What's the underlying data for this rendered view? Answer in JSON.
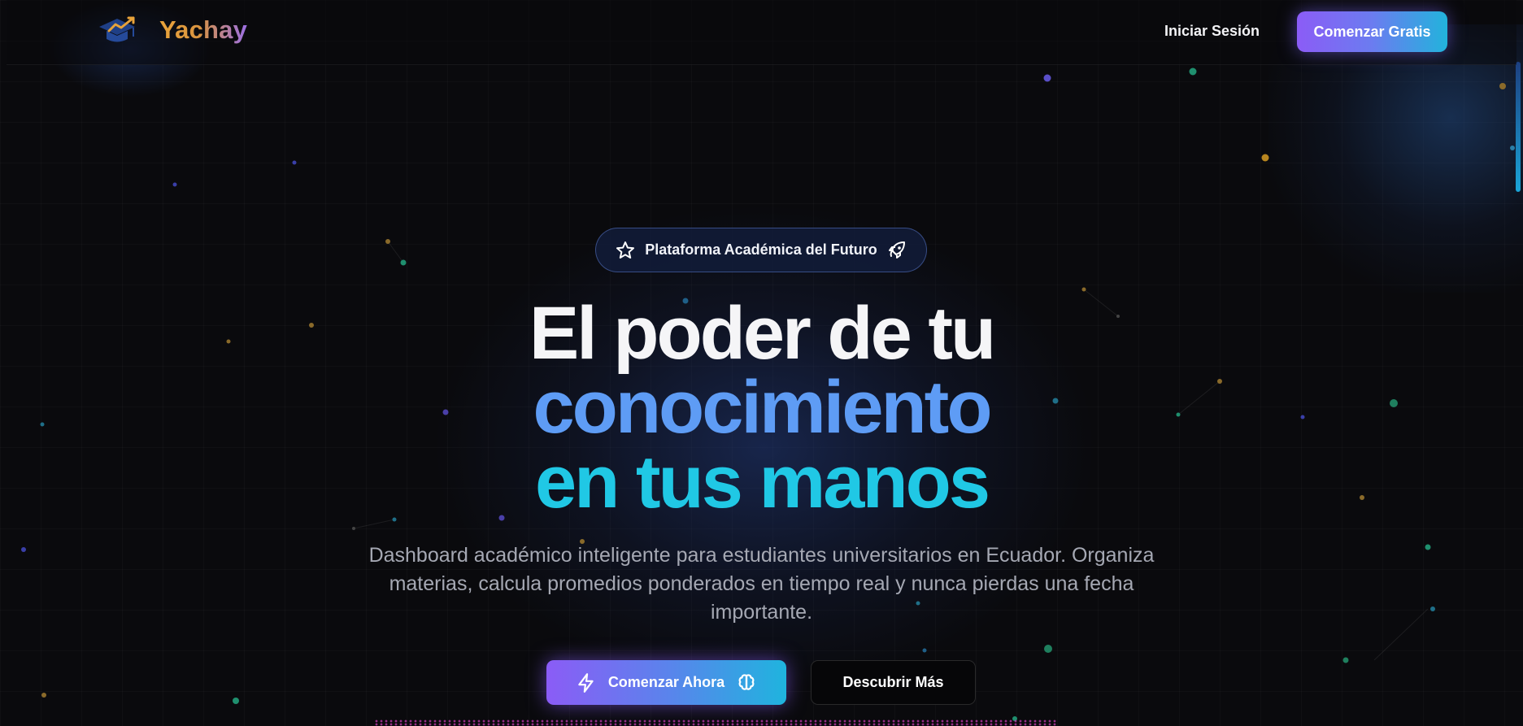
{
  "brand": {
    "name": "Yachay",
    "logo_icon": "graduation-cap-trend-icon"
  },
  "nav": {
    "login_label": "Iniciar Sesión",
    "cta_label": "Comenzar Gratis"
  },
  "badge": {
    "label": "Plataforma Académica del Futuro",
    "left_icon": "star-icon",
    "right_icon": "rocket-icon"
  },
  "hero": {
    "line1": "El poder de tu",
    "line2": "conocimiento",
    "line3": "en tus manos",
    "description": "Dashboard académico inteligente para estudiantes universitarios en Ecuador. Organiza materias, calcula promedios ponderados en tiempo real y nunca pierdas una fecha importante."
  },
  "actions": {
    "primary_label": "Comenzar Ahora",
    "primary_left_icon": "lightning-icon",
    "primary_right_icon": "brain-icon",
    "secondary_label": "Descubrir Más"
  },
  "colors": {
    "background": "#0a0a0d",
    "brand_gradient_start": "#e9a33a",
    "brand_gradient_end": "#9b6fe6",
    "cta_gradient_start": "#8b5cf6",
    "cta_gradient_end": "#22b3dc",
    "hero_line2": "#5e9cf5",
    "hero_line3": "#20c8e5"
  }
}
